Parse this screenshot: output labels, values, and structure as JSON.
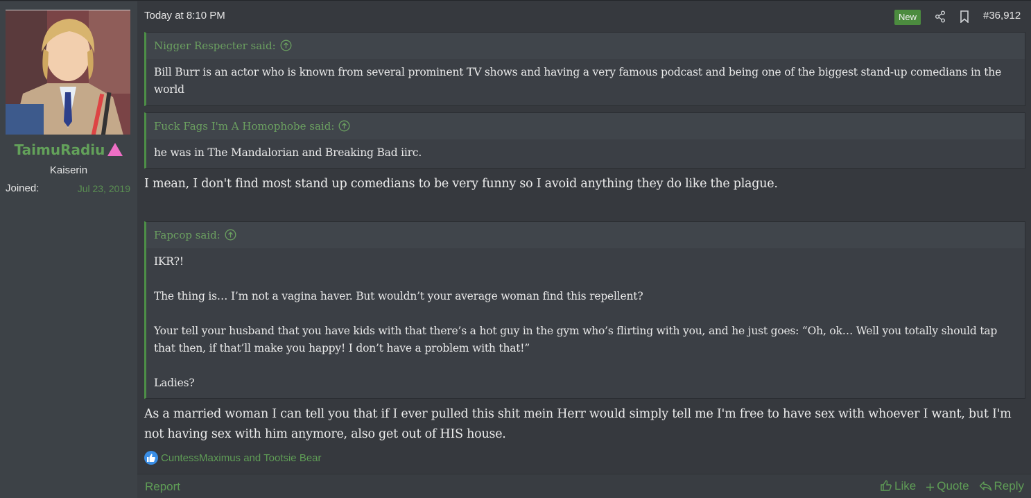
{
  "user": {
    "name": "TaimuRadiu",
    "title": "Kaiserin",
    "joined_label": "Joined:",
    "joined_date": "Jul 23, 2019"
  },
  "post": {
    "timestamp": "Today at 8:10 PM",
    "badge": "New",
    "number": "#36,912",
    "quotes": [
      {
        "author": "Nigger Respecter said:",
        "paragraphs": [
          "Bill Burr is an actor who is known from several prominent TV shows and having a very famous podcast and being one of the biggest stand-up comedians in the world"
        ]
      },
      {
        "author": "Fuck Fags I'm A Homophobe said:",
        "paragraphs": [
          "he was in The Mandalorian and Breaking Bad iirc."
        ]
      },
      {
        "author": "Fapcop said:",
        "paragraphs": [
          "IKR?!",
          "The thing is… I’m not a vagina haver. But wouldn’t your average woman find this repellent?",
          "Your tell your husband that you have kids with that there’s a hot guy in the gym who’s flirting with you, and he just goes: “Oh, ok… Well you totally should tap that then, if that’ll make you happy! I don’t have a problem with that!”",
          "Ladies?"
        ]
      }
    ],
    "message_1": "I mean, I don't find most stand up comedians to be very funny so I avoid anything they do like the plague.",
    "message_2": "As a married woman I can tell you that if I ever pulled this shit mein Herr would simply tell me I'm free to have sex with whoever I want, but I'm not having sex with him anymore, also get out of HIS house.",
    "reactions": "CuntessMaximus and Tootsie Bear"
  },
  "footer": {
    "report": "Report",
    "like": "Like",
    "quote": "Quote",
    "reply": "Reply"
  },
  "colors": {
    "accent_green": "#63a15a",
    "badge_green": "#4c8c3f",
    "role_triangle": "#ef6fc6",
    "like_blue": "#3a8ee6"
  }
}
